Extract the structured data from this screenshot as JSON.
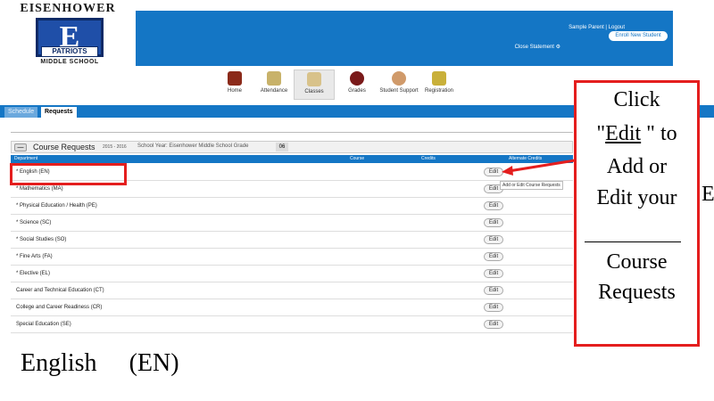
{
  "logo": {
    "arc_text": "EISENHOWER",
    "shield_letter": "E",
    "banner": "PATRIOTS",
    "school": "MIDDLE SCHOOL"
  },
  "header": {
    "user": "Sample Parent | Logout",
    "course_statement": "Close Statement ⚙",
    "enroll_button": "Enroll New Student",
    "accent_color": "#1476c5"
  },
  "nav": {
    "items": [
      {
        "label": "Home",
        "icon": "home-icon"
      },
      {
        "label": "Attendance",
        "icon": "attendance-icon"
      },
      {
        "label": "Classes",
        "icon": "classes-icon"
      },
      {
        "label": "Grades",
        "icon": "grades-icon"
      },
      {
        "label": "Student Support",
        "icon": "student-support-icon"
      },
      {
        "label": "Registration",
        "icon": "registration-icon"
      }
    ],
    "active": "Classes"
  },
  "tabs": {
    "schedule": "Schedule",
    "requests": "Requests"
  },
  "panel": {
    "collapse": "—",
    "title": "Course Requests",
    "years": "2015 - 2016",
    "meta": "School Year: Eisenhower Middle School   Grade",
    "grade": "06",
    "columns": {
      "department": "Department",
      "course": "Course",
      "credits": "Credits",
      "alt_credits": "Alternate Credits"
    },
    "rows": [
      {
        "label": "* English (EN)",
        "edit": "Edit"
      },
      {
        "label": "* Mathematics (MA)",
        "edit": "Edit"
      },
      {
        "label": "* Physical Education / Health (PE)",
        "edit": "Edit"
      },
      {
        "label": "* Science (SC)",
        "edit": "Edit"
      },
      {
        "label": "* Social Studies (SO)",
        "edit": "Edit"
      },
      {
        "label": "* Fine Arts (FA)",
        "edit": "Edit"
      },
      {
        "label": "* Elective (EL)",
        "edit": "Edit"
      },
      {
        "label": "Career and Technical Education (CT)",
        "edit": "Edit"
      },
      {
        "label": "College and Career Readiness (CR)",
        "edit": "Edit"
      },
      {
        "label": "Special Education (SE)",
        "edit": "Edit"
      }
    ],
    "tooltip": "Add or Edit Course Requests"
  },
  "callout": {
    "line1": "Click",
    "line2_q1": "\"",
    "line2_edit": "Edit",
    "line2_q2": " \" to",
    "line3": "Add  or",
    "line4": "Edit your",
    "overflow": "E",
    "line5": "Course",
    "line6": "Requests",
    "color": "#e41e1e"
  },
  "footer": {
    "subject": "English",
    "code": "(EN)"
  }
}
